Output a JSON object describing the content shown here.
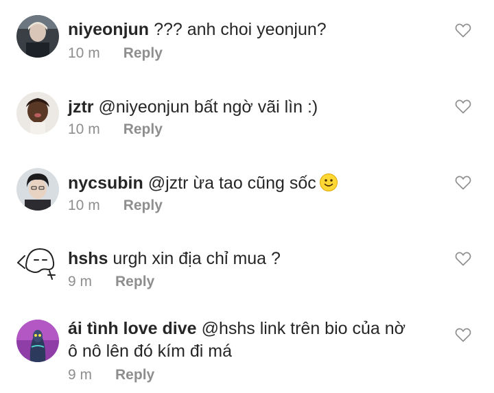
{
  "comments": [
    {
      "username": "niyeonjun",
      "text": "??? anh choi yeonjun?",
      "time": "10 m",
      "reply_label": "Reply"
    },
    {
      "username": "jztr",
      "text": "@niyeonjun bất ngờ vãi lìn :)",
      "time": "10 m",
      "reply_label": "Reply"
    },
    {
      "username": "nycsubin",
      "text": "@jztr ừa tao cũng sốc",
      "time": "10 m",
      "reply_label": "Reply",
      "emoji": "slightly-smiling-face-emoji"
    },
    {
      "username": "hshs",
      "text": "urgh xin địa chỉ mua ?",
      "time": "9 m",
      "reply_label": "Reply"
    },
    {
      "username": "ái tình love dive",
      "text": "@hshs link trên bio của nờ",
      "text_line2": "ô nô lên đó kím đi má",
      "time": "9 m",
      "reply_label": "Reply"
    }
  ],
  "icons": {
    "like": "heart-outline-icon"
  },
  "colors": {
    "text": "#262626",
    "secondary": "#8e8e8e",
    "background": "#ffffff"
  }
}
